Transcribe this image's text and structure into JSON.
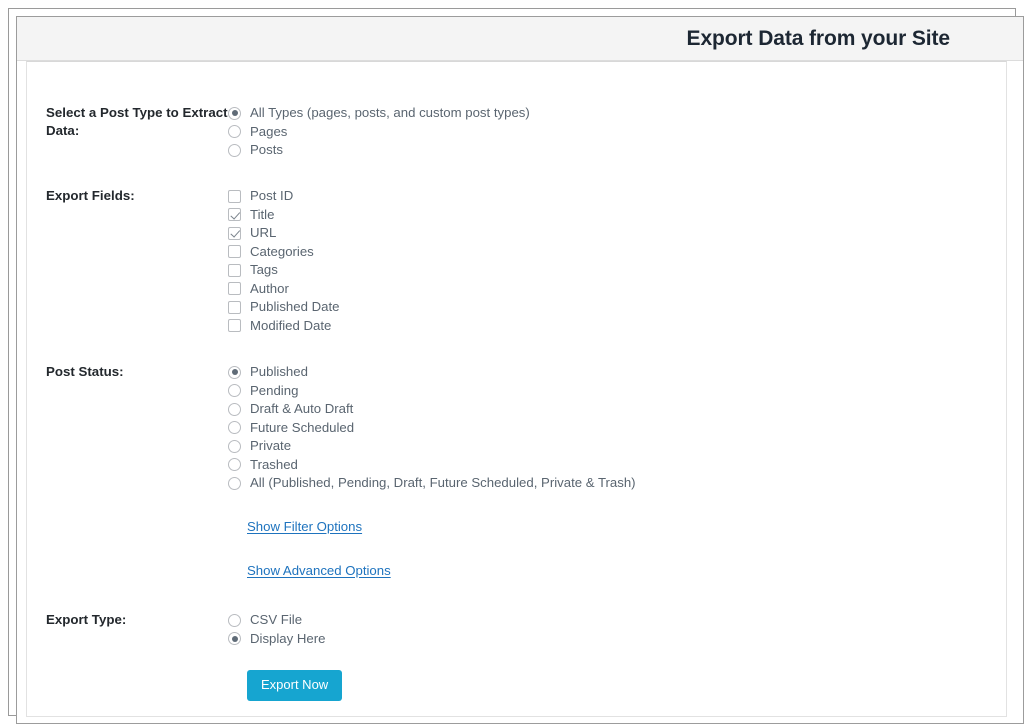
{
  "header": {
    "title": "Export Data from your Site"
  },
  "form": {
    "post_type": {
      "label": "Select a Post Type to Extract Data:",
      "name": "post-type",
      "options": [
        {
          "label": "All Types (pages, posts, and custom post types)",
          "value": "all",
          "selected": true
        },
        {
          "label": "Pages",
          "value": "pages",
          "selected": false
        },
        {
          "label": "Posts",
          "value": "posts",
          "selected": false
        }
      ]
    },
    "export_fields": {
      "label": "Export Fields:",
      "options": [
        {
          "label": "Post ID",
          "value": "post_id",
          "checked": false
        },
        {
          "label": "Title",
          "value": "title",
          "checked": true
        },
        {
          "label": "URL",
          "value": "url",
          "checked": true
        },
        {
          "label": "Categories",
          "value": "categories",
          "checked": false
        },
        {
          "label": "Tags",
          "value": "tags",
          "checked": false
        },
        {
          "label": "Author",
          "value": "author",
          "checked": false
        },
        {
          "label": "Published Date",
          "value": "published_date",
          "checked": false
        },
        {
          "label": "Modified Date",
          "value": "modified_date",
          "checked": false
        }
      ]
    },
    "post_status": {
      "label": "Post Status:",
      "name": "post-status",
      "options": [
        {
          "label": "Published",
          "value": "published",
          "selected": true
        },
        {
          "label": "Pending",
          "value": "pending",
          "selected": false
        },
        {
          "label": "Draft & Auto Draft",
          "value": "draft",
          "selected": false
        },
        {
          "label": "Future Scheduled",
          "value": "future",
          "selected": false
        },
        {
          "label": "Private",
          "value": "private",
          "selected": false
        },
        {
          "label": "Trashed",
          "value": "trashed",
          "selected": false
        },
        {
          "label": "All (Published, Pending, Draft, Future Scheduled, Private & Trash)",
          "value": "all",
          "selected": false
        }
      ]
    },
    "links": {
      "filter_options": "Show Filter Options",
      "advanced_options": "Show Advanced Options"
    },
    "export_type": {
      "label": "Export Type:",
      "name": "export-type",
      "options": [
        {
          "label": "CSV File",
          "value": "csv",
          "selected": false
        },
        {
          "label": "Display Here",
          "value": "display",
          "selected": true
        }
      ]
    },
    "submit": {
      "label": "Export Now"
    }
  },
  "colors": {
    "accent_button": "#16a5d0",
    "link": "#1e73be",
    "label_text": "#23282d",
    "option_text": "#5a6570",
    "header_bg": "#f4f4f4",
    "frame_border": "#9c9c9c"
  }
}
